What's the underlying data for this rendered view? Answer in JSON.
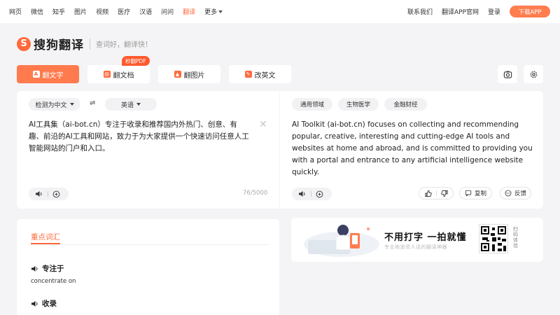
{
  "topnav": {
    "links": [
      "网页",
      "微信",
      "知乎",
      "图片",
      "视频",
      "医疗",
      "汉语",
      "问问",
      "翻译",
      "更多"
    ],
    "right_links": [
      "联系我们",
      "翻译APP官网",
      "登录"
    ],
    "download_button": "下载APP"
  },
  "brand": {
    "logo_letter": "S",
    "name": "搜狗翻译",
    "slogan": "查词好，翻译快！"
  },
  "tabs": [
    "翻文字",
    "翻文档",
    "翻图片",
    "改英文"
  ],
  "promo_badge": "秒翻PDF",
  "translate": {
    "source_lang": "检测为中文",
    "swap_symbol": "⇌",
    "target_lang": "英语",
    "source_text": "AI工具集（ai-bot.cn）专注于收录和推荐国内外热门、创意、有趣、前沿的AI工具和网站，致力于为大家提供一个快速访问任意人工智能网站的门户和入口。",
    "char_count": "76/5000",
    "domains": [
      "通用领域",
      "生物医学",
      "金融财经"
    ],
    "target_text": "AI Toolkit (ai-bot.cn) focuses on collecting and recommending popular, creative, interesting and cutting-edge AI tools and websites at home and abroad, and is committed to providing you with a portal and entrance to any artificial intelligence website quickly.",
    "copy_label": "复制",
    "feedback_label": "反馈"
  },
  "vocab": {
    "title": "重点词汇",
    "items": [
      {
        "word": "专注于",
        "definition": "concentrate on"
      },
      {
        "word": "收录",
        "definition": ""
      }
    ]
  },
  "banner": {
    "title": "不用打字 一拍就懂",
    "subtitle": "专业地道资人话的翻译神器",
    "qr_label": "扫码体验"
  },
  "colors": {
    "accent": "#ff6a3d",
    "page_bg": "#f4f4f6"
  }
}
